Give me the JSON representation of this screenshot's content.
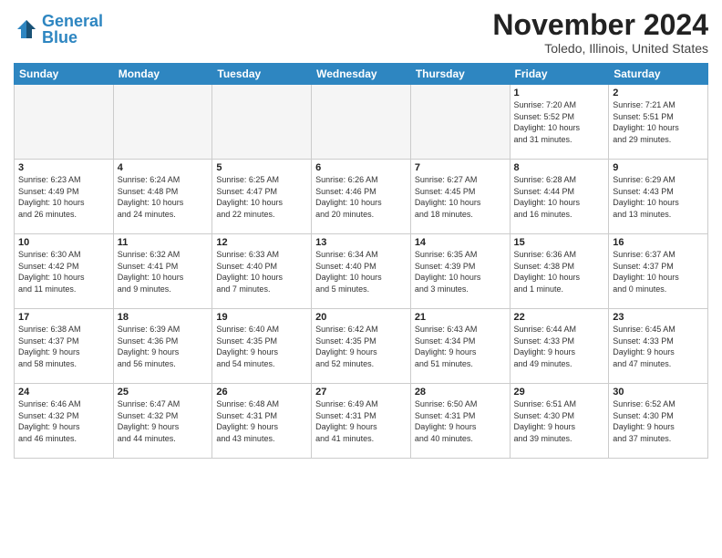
{
  "header": {
    "logo_line1": "General",
    "logo_line2": "Blue",
    "month": "November 2024",
    "location": "Toledo, Illinois, United States"
  },
  "weekdays": [
    "Sunday",
    "Monday",
    "Tuesday",
    "Wednesday",
    "Thursday",
    "Friday",
    "Saturday"
  ],
  "weeks": [
    [
      {
        "day": "",
        "info": ""
      },
      {
        "day": "",
        "info": ""
      },
      {
        "day": "",
        "info": ""
      },
      {
        "day": "",
        "info": ""
      },
      {
        "day": "",
        "info": ""
      },
      {
        "day": "1",
        "info": "Sunrise: 7:20 AM\nSunset: 5:52 PM\nDaylight: 10 hours\nand 31 minutes."
      },
      {
        "day": "2",
        "info": "Sunrise: 7:21 AM\nSunset: 5:51 PM\nDaylight: 10 hours\nand 29 minutes."
      }
    ],
    [
      {
        "day": "3",
        "info": "Sunrise: 6:23 AM\nSunset: 4:49 PM\nDaylight: 10 hours\nand 26 minutes."
      },
      {
        "day": "4",
        "info": "Sunrise: 6:24 AM\nSunset: 4:48 PM\nDaylight: 10 hours\nand 24 minutes."
      },
      {
        "day": "5",
        "info": "Sunrise: 6:25 AM\nSunset: 4:47 PM\nDaylight: 10 hours\nand 22 minutes."
      },
      {
        "day": "6",
        "info": "Sunrise: 6:26 AM\nSunset: 4:46 PM\nDaylight: 10 hours\nand 20 minutes."
      },
      {
        "day": "7",
        "info": "Sunrise: 6:27 AM\nSunset: 4:45 PM\nDaylight: 10 hours\nand 18 minutes."
      },
      {
        "day": "8",
        "info": "Sunrise: 6:28 AM\nSunset: 4:44 PM\nDaylight: 10 hours\nand 16 minutes."
      },
      {
        "day": "9",
        "info": "Sunrise: 6:29 AM\nSunset: 4:43 PM\nDaylight: 10 hours\nand 13 minutes."
      }
    ],
    [
      {
        "day": "10",
        "info": "Sunrise: 6:30 AM\nSunset: 4:42 PM\nDaylight: 10 hours\nand 11 minutes."
      },
      {
        "day": "11",
        "info": "Sunrise: 6:32 AM\nSunset: 4:41 PM\nDaylight: 10 hours\nand 9 minutes."
      },
      {
        "day": "12",
        "info": "Sunrise: 6:33 AM\nSunset: 4:40 PM\nDaylight: 10 hours\nand 7 minutes."
      },
      {
        "day": "13",
        "info": "Sunrise: 6:34 AM\nSunset: 4:40 PM\nDaylight: 10 hours\nand 5 minutes."
      },
      {
        "day": "14",
        "info": "Sunrise: 6:35 AM\nSunset: 4:39 PM\nDaylight: 10 hours\nand 3 minutes."
      },
      {
        "day": "15",
        "info": "Sunrise: 6:36 AM\nSunset: 4:38 PM\nDaylight: 10 hours\nand 1 minute."
      },
      {
        "day": "16",
        "info": "Sunrise: 6:37 AM\nSunset: 4:37 PM\nDaylight: 10 hours\nand 0 minutes."
      }
    ],
    [
      {
        "day": "17",
        "info": "Sunrise: 6:38 AM\nSunset: 4:37 PM\nDaylight: 9 hours\nand 58 minutes."
      },
      {
        "day": "18",
        "info": "Sunrise: 6:39 AM\nSunset: 4:36 PM\nDaylight: 9 hours\nand 56 minutes."
      },
      {
        "day": "19",
        "info": "Sunrise: 6:40 AM\nSunset: 4:35 PM\nDaylight: 9 hours\nand 54 minutes."
      },
      {
        "day": "20",
        "info": "Sunrise: 6:42 AM\nSunset: 4:35 PM\nDaylight: 9 hours\nand 52 minutes."
      },
      {
        "day": "21",
        "info": "Sunrise: 6:43 AM\nSunset: 4:34 PM\nDaylight: 9 hours\nand 51 minutes."
      },
      {
        "day": "22",
        "info": "Sunrise: 6:44 AM\nSunset: 4:33 PM\nDaylight: 9 hours\nand 49 minutes."
      },
      {
        "day": "23",
        "info": "Sunrise: 6:45 AM\nSunset: 4:33 PM\nDaylight: 9 hours\nand 47 minutes."
      }
    ],
    [
      {
        "day": "24",
        "info": "Sunrise: 6:46 AM\nSunset: 4:32 PM\nDaylight: 9 hours\nand 46 minutes."
      },
      {
        "day": "25",
        "info": "Sunrise: 6:47 AM\nSunset: 4:32 PM\nDaylight: 9 hours\nand 44 minutes."
      },
      {
        "day": "26",
        "info": "Sunrise: 6:48 AM\nSunset: 4:31 PM\nDaylight: 9 hours\nand 43 minutes."
      },
      {
        "day": "27",
        "info": "Sunrise: 6:49 AM\nSunset: 4:31 PM\nDaylight: 9 hours\nand 41 minutes."
      },
      {
        "day": "28",
        "info": "Sunrise: 6:50 AM\nSunset: 4:31 PM\nDaylight: 9 hours\nand 40 minutes."
      },
      {
        "day": "29",
        "info": "Sunrise: 6:51 AM\nSunset: 4:30 PM\nDaylight: 9 hours\nand 39 minutes."
      },
      {
        "day": "30",
        "info": "Sunrise: 6:52 AM\nSunset: 4:30 PM\nDaylight: 9 hours\nand 37 minutes."
      }
    ]
  ]
}
